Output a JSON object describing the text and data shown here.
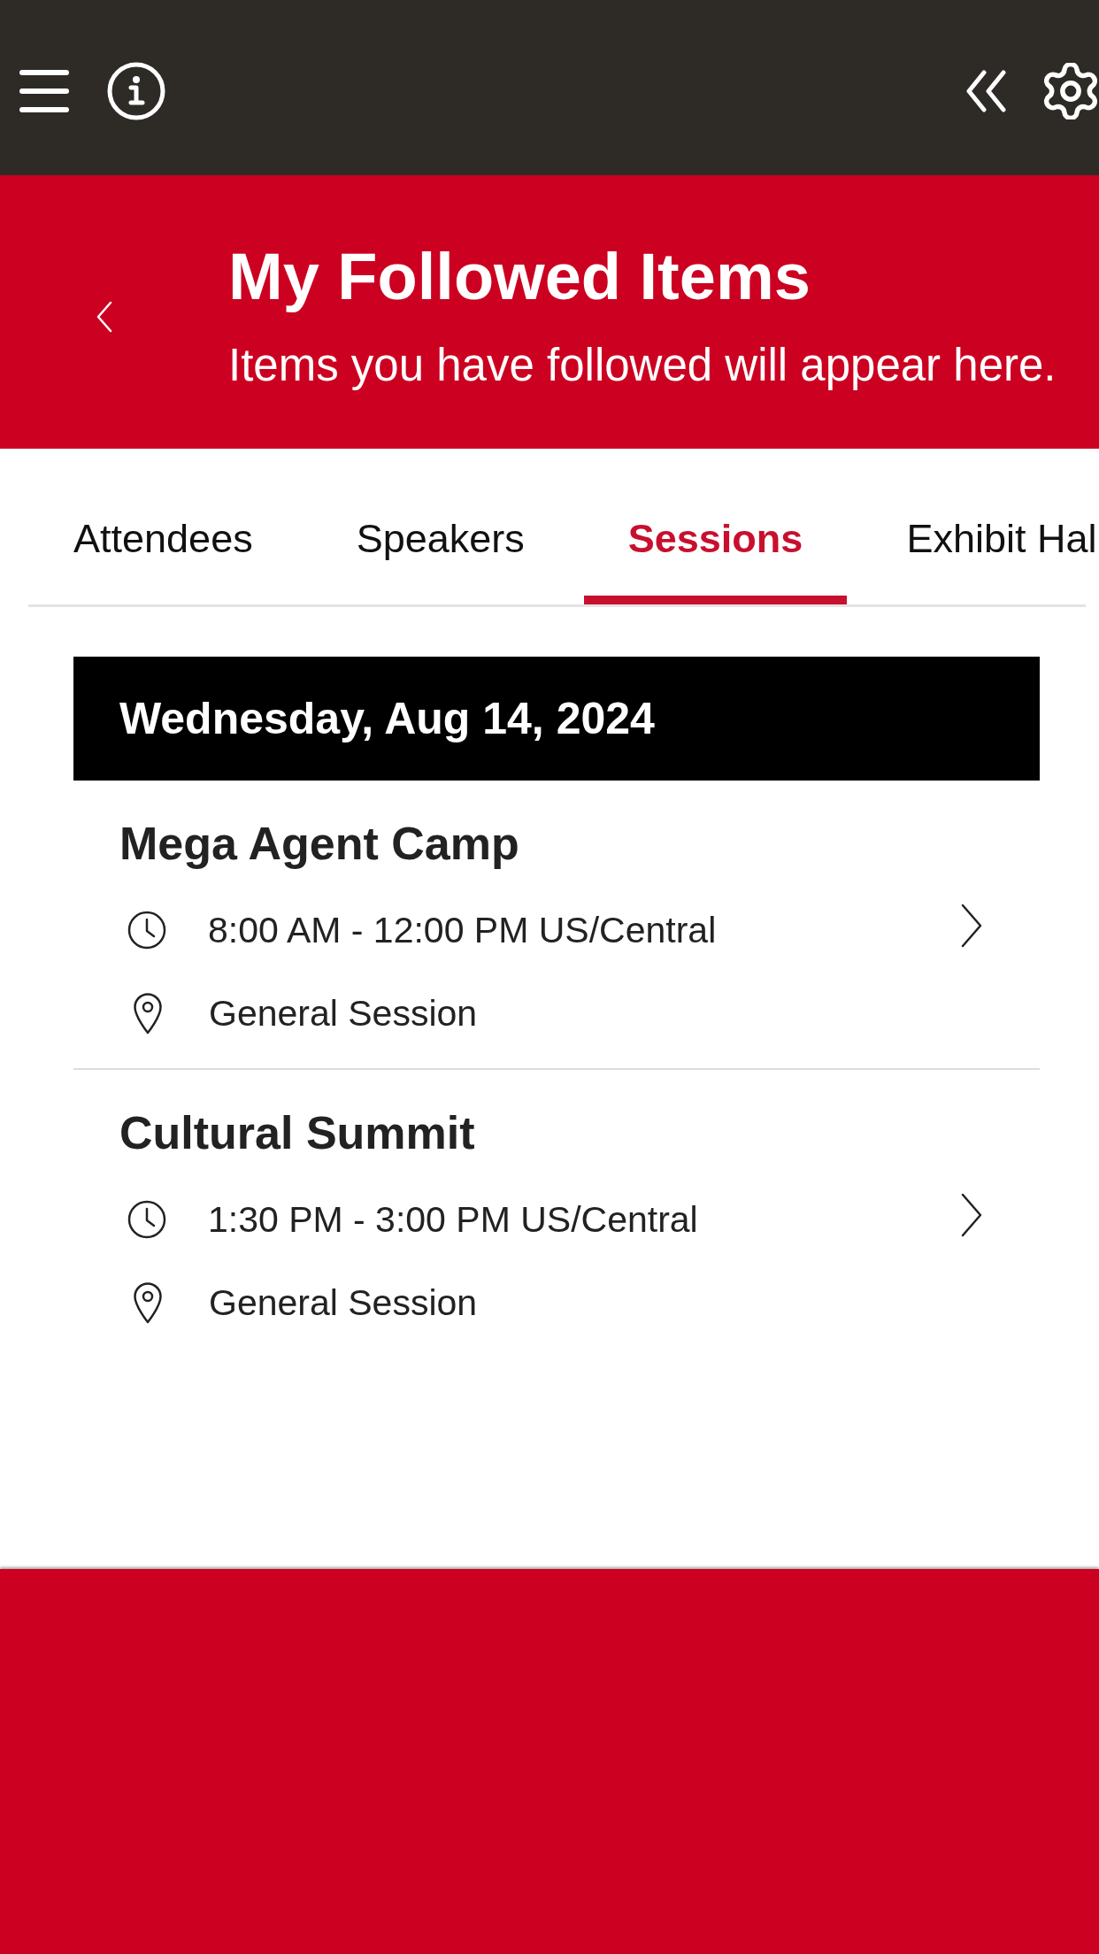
{
  "header": {
    "title": "My Followed Items",
    "subtitle": "Items you have followed will appear here."
  },
  "tabs": [
    {
      "label": "Attendees",
      "selected": false
    },
    {
      "label": "Speakers",
      "selected": false
    },
    {
      "label": "Sessions",
      "selected": true
    },
    {
      "label": "Exhibit Hal",
      "selected": false
    }
  ],
  "session_groups": [
    {
      "date": "Wednesday, Aug 14, 2024",
      "sessions": [
        {
          "title": "Mega Agent Camp",
          "time": "8:00 AM - 12:00 PM US/Central",
          "location": "General Session"
        },
        {
          "title": "Cultural Summit",
          "time": "1:30 PM - 3:00 PM US/Central",
          "location": "General Session"
        }
      ]
    }
  ]
}
